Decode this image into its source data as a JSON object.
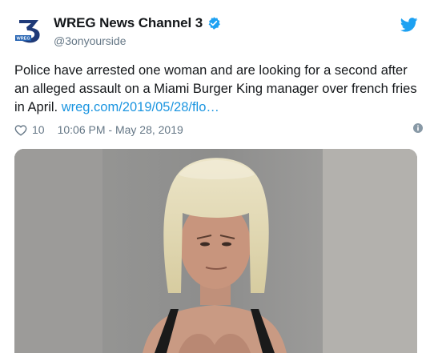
{
  "account": {
    "display_name": "WREG News Channel 3",
    "handle": "@3onyourside",
    "verified": true,
    "avatar_icon": "wreg-3-logo-icon",
    "avatar_text": "WREG"
  },
  "tweet": {
    "text": "Police have arrested one woman and are looking for a second after an alleged assault on a Miami Burger King manager over french fries in April. ",
    "link_text": "wreg.com/2019/05/28/flo…",
    "like_count": "10",
    "timestamp": "10:06 PM - May 28, 2019"
  },
  "icons": {
    "brand": "twitter-bird-icon",
    "like": "heart-icon",
    "info": "info-icon"
  },
  "colors": {
    "link": "#1b95e0",
    "verified": "#1da1f2",
    "brand": "#1da1f2",
    "secondary_text": "#657786"
  },
  "media": {
    "description_icon": "mugshot-photo"
  }
}
